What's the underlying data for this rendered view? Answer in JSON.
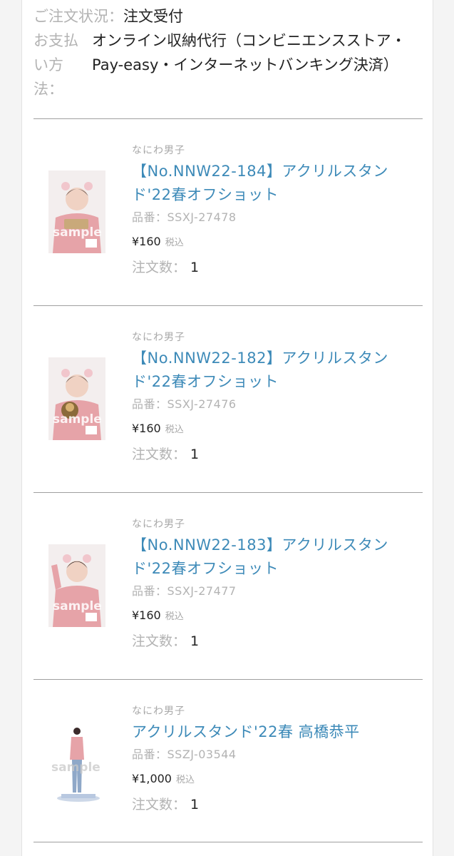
{
  "order": {
    "status_label": "ご注文状況：",
    "status_value": "注文受付",
    "payment_label": "お支払い方法：",
    "payment_value": "オンライン収納代行（コンビニエンスストア・Pay-easy・インターネットバンキング決済）"
  },
  "labels": {
    "code_prefix": "品番：",
    "tax": "税込",
    "qty_label": "注文数：",
    "watermark": "sample"
  },
  "items": [
    {
      "brand": "なにわ男子",
      "title": "【No.NNW22-184】アクリルスタンド'22春オフショット",
      "code": "SSXJ-27478",
      "price": "¥160",
      "qty": "1"
    },
    {
      "brand": "なにわ男子",
      "title": "【No.NNW22-182】アクリルスタンド'22春オフショット",
      "code": "SSXJ-27476",
      "price": "¥160",
      "qty": "1"
    },
    {
      "brand": "なにわ男子",
      "title": "【No.NNW22-183】アクリルスタンド'22春オフショット",
      "code": "SSXJ-27477",
      "price": "¥160",
      "qty": "1"
    },
    {
      "brand": "なにわ男子",
      "title": "アクリルスタンド'22春 高橋恭平",
      "code": "SSZJ-03544",
      "price": "¥1,000",
      "qty": "1"
    }
  ],
  "colors": {
    "link": "#3d8ab8",
    "muted": "#b3b3b3",
    "divider": "#9f9f9f",
    "hoodie": "#e6a3a8"
  }
}
